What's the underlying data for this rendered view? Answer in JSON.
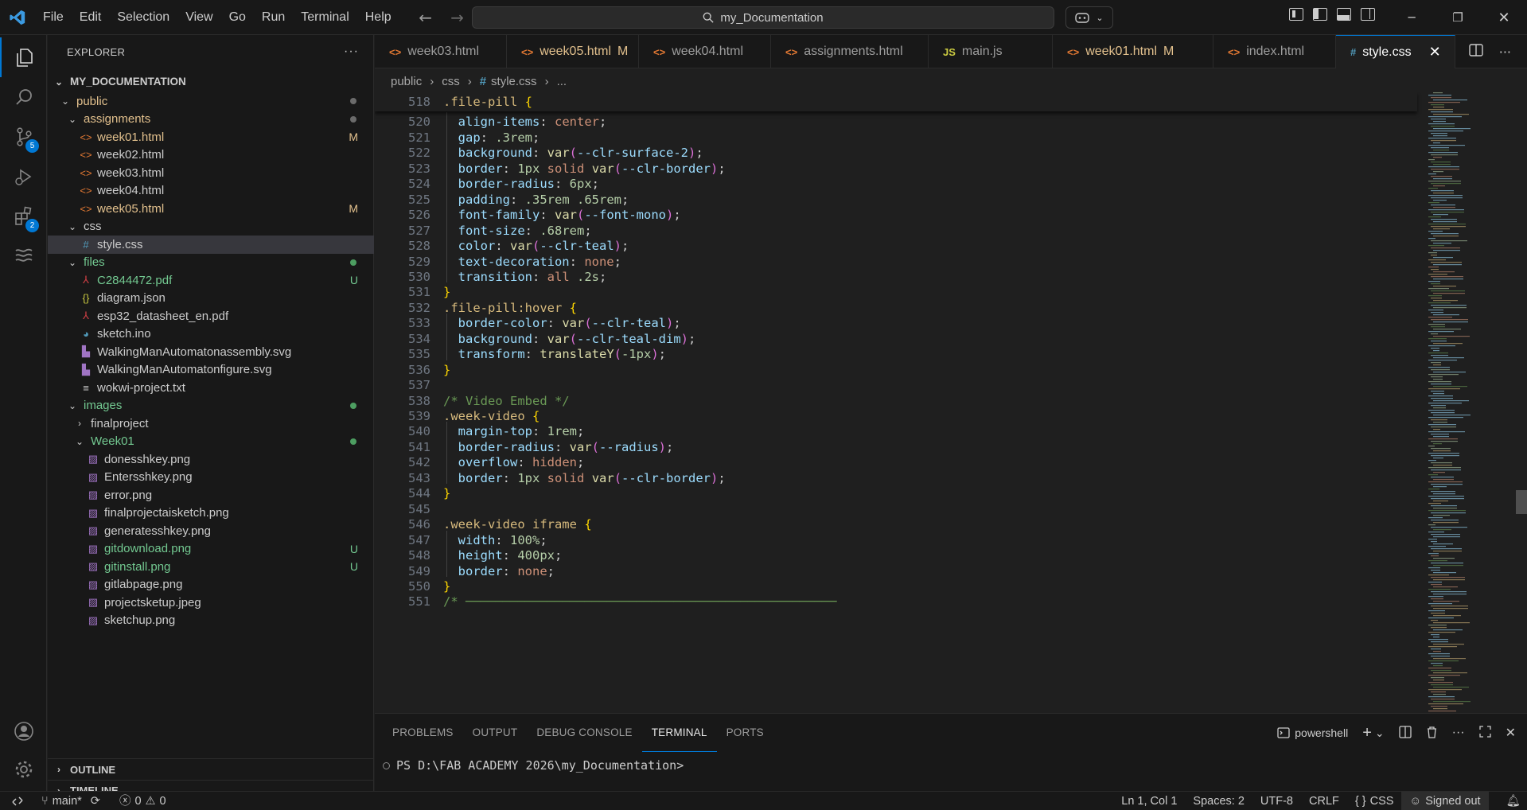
{
  "menu": [
    "File",
    "Edit",
    "Selection",
    "View",
    "Go",
    "Run",
    "Terminal",
    "Help"
  ],
  "search": {
    "text": "my_Documentation"
  },
  "activity": {
    "scm_badge": "5",
    "extensions_badge": "2"
  },
  "explorer": {
    "title": "EXPLORER",
    "root": "MY_DOCUMENTATION",
    "items": [
      {
        "label": "public",
        "depth": 0,
        "kind": "folder-open",
        "color": "#e2c08d",
        "marker": "dot",
        "marker_color": "#6b6b6b"
      },
      {
        "label": "assignments",
        "depth": 1,
        "kind": "folder-open",
        "color": "#e2c08d",
        "marker": "dot",
        "marker_color": "#6b6b6b"
      },
      {
        "label": "week01.html",
        "depth": 2,
        "kind": "html",
        "color": "#e2c08d",
        "marker": "M",
        "marker_color": "#e2c08d"
      },
      {
        "label": "week02.html",
        "depth": 2,
        "kind": "html",
        "color": "#cccccc",
        "marker": "",
        "marker_color": ""
      },
      {
        "label": "week03.html",
        "depth": 2,
        "kind": "html",
        "color": "#cccccc",
        "marker": "",
        "marker_color": ""
      },
      {
        "label": "week04.html",
        "depth": 2,
        "kind": "html",
        "color": "#cccccc",
        "marker": "",
        "marker_color": ""
      },
      {
        "label": "week05.html",
        "depth": 2,
        "kind": "html",
        "color": "#e2c08d",
        "marker": "M",
        "marker_color": "#e2c08d"
      },
      {
        "label": "css",
        "depth": 1,
        "kind": "folder-open",
        "color": "#cccccc",
        "marker": "",
        "marker_color": ""
      },
      {
        "label": "style.css",
        "depth": 2,
        "kind": "css",
        "color": "#cccccc",
        "marker": "",
        "marker_color": "",
        "selected": true
      },
      {
        "label": "files",
        "depth": 1,
        "kind": "folder-open",
        "color": "#73c991",
        "marker": "dot",
        "marker_color": "#4d9e61"
      },
      {
        "label": "C2844472.pdf",
        "depth": 2,
        "kind": "pdf",
        "color": "#73c991",
        "marker": "U",
        "marker_color": "#73c991"
      },
      {
        "label": "diagram.json",
        "depth": 2,
        "kind": "json",
        "color": "#cccccc",
        "marker": "",
        "marker_color": ""
      },
      {
        "label": "esp32_datasheet_en.pdf",
        "depth": 2,
        "kind": "pdf",
        "color": "#cccccc",
        "marker": "",
        "marker_color": ""
      },
      {
        "label": "sketch.ino",
        "depth": 2,
        "kind": "ino",
        "color": "#cccccc",
        "marker": "",
        "marker_color": ""
      },
      {
        "label": "WalkingManAutomatonassembly.svg",
        "depth": 2,
        "kind": "svg",
        "color": "#cccccc",
        "marker": "",
        "marker_color": ""
      },
      {
        "label": "WalkingManAutomatonfigure.svg",
        "depth": 2,
        "kind": "svg",
        "color": "#cccccc",
        "marker": "",
        "marker_color": ""
      },
      {
        "label": "wokwi-project.txt",
        "depth": 2,
        "kind": "txt",
        "color": "#cccccc",
        "marker": "",
        "marker_color": ""
      },
      {
        "label": "images",
        "depth": 1,
        "kind": "folder-open",
        "color": "#73c991",
        "marker": "dot",
        "marker_color": "#4d9e61"
      },
      {
        "label": "finalproject",
        "depth": 2,
        "kind": "folder-closed",
        "color": "#cccccc",
        "marker": "",
        "marker_color": ""
      },
      {
        "label": "Week01",
        "depth": 2,
        "kind": "folder-open",
        "color": "#73c991",
        "marker": "dot",
        "marker_color": "#4d9e61"
      },
      {
        "label": "donesshkey.png",
        "depth": 3,
        "kind": "png",
        "color": "#cccccc",
        "marker": "",
        "marker_color": ""
      },
      {
        "label": "Entersshkey.png",
        "depth": 3,
        "kind": "png",
        "color": "#cccccc",
        "marker": "",
        "marker_color": ""
      },
      {
        "label": "error.png",
        "depth": 3,
        "kind": "png",
        "color": "#cccccc",
        "marker": "",
        "marker_color": ""
      },
      {
        "label": "finalprojectaisketch.png",
        "depth": 3,
        "kind": "png",
        "color": "#cccccc",
        "marker": "",
        "marker_color": ""
      },
      {
        "label": "generatesshkey.png",
        "depth": 3,
        "kind": "png",
        "color": "#cccccc",
        "marker": "",
        "marker_color": ""
      },
      {
        "label": "gitdownload.png",
        "depth": 3,
        "kind": "png",
        "color": "#73c991",
        "marker": "U",
        "marker_color": "#73c991"
      },
      {
        "label": "gitinstall.png",
        "depth": 3,
        "kind": "png",
        "color": "#73c991",
        "marker": "U",
        "marker_color": "#73c991"
      },
      {
        "label": "gitlabpage.png",
        "depth": 3,
        "kind": "png",
        "color": "#cccccc",
        "marker": "",
        "marker_color": ""
      },
      {
        "label": "projectsketup.jpeg",
        "depth": 3,
        "kind": "png",
        "color": "#cccccc",
        "marker": "",
        "marker_color": ""
      },
      {
        "label": "sketchup.png",
        "depth": 3,
        "kind": "png",
        "color": "#cccccc",
        "marker": "",
        "marker_color": ""
      }
    ],
    "outline": "OUTLINE",
    "timeline": "TIMELINE"
  },
  "tabs": [
    {
      "label": "week03.html",
      "icon": "<>",
      "icon_color": "#e37933",
      "color": "#9d9d9d",
      "mod": ""
    },
    {
      "label": "week05.html",
      "icon": "<>",
      "icon_color": "#e37933",
      "color": "#e2c08d",
      "mod": "M"
    },
    {
      "label": "week04.html",
      "icon": "<>",
      "icon_color": "#e37933",
      "color": "#9d9d9d",
      "mod": ""
    },
    {
      "label": "assignments.html",
      "icon": "<>",
      "icon_color": "#e37933",
      "color": "#9d9d9d",
      "mod": ""
    },
    {
      "label": "main.js",
      "icon": "JS",
      "icon_color": "#cbcb41",
      "color": "#9d9d9d",
      "mod": ""
    },
    {
      "label": "week01.html",
      "icon": "<>",
      "icon_color": "#e37933",
      "color": "#e2c08d",
      "mod": "M"
    },
    {
      "label": "index.html",
      "icon": "<>",
      "icon_color": "#e37933",
      "color": "#9d9d9d",
      "mod": ""
    },
    {
      "label": "style.css",
      "icon": "#",
      "icon_color": "#519aba",
      "color": "#ffffff",
      "mod": "",
      "active": true
    }
  ],
  "breadcrumb": [
    "public",
    "css",
    "style.css",
    "..."
  ],
  "code": [
    {
      "n": "518",
      "sticky": true,
      "t": [
        [
          ".file-pill",
          "sel"
        ],
        [
          " ",
          ""
        ],
        [
          "{",
          "br"
        ]
      ]
    },
    {
      "n": "520",
      "t": [
        [
          "  align-items",
          "prop"
        ],
        [
          ": ",
          "p"
        ],
        [
          "center",
          "val"
        ],
        [
          ";",
          "p"
        ]
      ]
    },
    {
      "n": "521",
      "t": [
        [
          "  gap",
          "prop"
        ],
        [
          ": ",
          "p"
        ],
        [
          ".3rem",
          "num"
        ],
        [
          ";",
          "p"
        ]
      ]
    },
    {
      "n": "522",
      "t": [
        [
          "  background",
          "prop"
        ],
        [
          ": ",
          "p"
        ],
        [
          "var",
          "fn"
        ],
        [
          "(",
          "br2"
        ],
        [
          "--clr-surface-2",
          "var"
        ],
        [
          ")",
          "br2"
        ],
        [
          ";",
          "p"
        ]
      ]
    },
    {
      "n": "523",
      "t": [
        [
          "  border",
          "prop"
        ],
        [
          ": ",
          "p"
        ],
        [
          "1px",
          "num"
        ],
        [
          " ",
          "p"
        ],
        [
          "solid",
          "val"
        ],
        [
          " ",
          "p"
        ],
        [
          "var",
          "fn"
        ],
        [
          "(",
          "br2"
        ],
        [
          "--clr-border",
          "var"
        ],
        [
          ")",
          "br2"
        ],
        [
          ";",
          "p"
        ]
      ]
    },
    {
      "n": "524",
      "t": [
        [
          "  border-radius",
          "prop"
        ],
        [
          ": ",
          "p"
        ],
        [
          "6px",
          "num"
        ],
        [
          ";",
          "p"
        ]
      ]
    },
    {
      "n": "525",
      "t": [
        [
          "  padding",
          "prop"
        ],
        [
          ": ",
          "p"
        ],
        [
          ".35rem",
          "num"
        ],
        [
          " ",
          "p"
        ],
        [
          ".65rem",
          "num"
        ],
        [
          ";",
          "p"
        ]
      ]
    },
    {
      "n": "526",
      "t": [
        [
          "  font-family",
          "prop"
        ],
        [
          ": ",
          "p"
        ],
        [
          "var",
          "fn"
        ],
        [
          "(",
          "br2"
        ],
        [
          "--font-mono",
          "var"
        ],
        [
          ")",
          "br2"
        ],
        [
          ";",
          "p"
        ]
      ]
    },
    {
      "n": "527",
      "t": [
        [
          "  font-size",
          "prop"
        ],
        [
          ": ",
          "p"
        ],
        [
          ".68rem",
          "num"
        ],
        [
          ";",
          "p"
        ]
      ]
    },
    {
      "n": "528",
      "t": [
        [
          "  color",
          "prop"
        ],
        [
          ": ",
          "p"
        ],
        [
          "var",
          "fn"
        ],
        [
          "(",
          "br2"
        ],
        [
          "--clr-teal",
          "var"
        ],
        [
          ")",
          "br2"
        ],
        [
          ";",
          "p"
        ]
      ]
    },
    {
      "n": "529",
      "t": [
        [
          "  text-decoration",
          "prop"
        ],
        [
          ": ",
          "p"
        ],
        [
          "none",
          "val"
        ],
        [
          ";",
          "p"
        ]
      ]
    },
    {
      "n": "530",
      "t": [
        [
          "  transition",
          "prop"
        ],
        [
          ": ",
          "p"
        ],
        [
          "all",
          "val"
        ],
        [
          " ",
          "p"
        ],
        [
          ".2s",
          "num"
        ],
        [
          ";",
          "p"
        ]
      ]
    },
    {
      "n": "531",
      "t": [
        [
          "}",
          "br"
        ]
      ]
    },
    {
      "n": "532",
      "t": [
        [
          ".file-pill:hover",
          "sel"
        ],
        [
          " ",
          ""
        ],
        [
          "{",
          "br"
        ]
      ]
    },
    {
      "n": "533",
      "t": [
        [
          "  border-color",
          "prop"
        ],
        [
          ": ",
          "p"
        ],
        [
          "var",
          "fn"
        ],
        [
          "(",
          "br2"
        ],
        [
          "--clr-teal",
          "var"
        ],
        [
          ")",
          "br2"
        ],
        [
          ";",
          "p"
        ]
      ]
    },
    {
      "n": "534",
      "t": [
        [
          "  background",
          "prop"
        ],
        [
          ": ",
          "p"
        ],
        [
          "var",
          "fn"
        ],
        [
          "(",
          "br2"
        ],
        [
          "--clr-teal-dim",
          "var"
        ],
        [
          ")",
          "br2"
        ],
        [
          ";",
          "p"
        ]
      ]
    },
    {
      "n": "535",
      "t": [
        [
          "  transform",
          "prop"
        ],
        [
          ": ",
          "p"
        ],
        [
          "translateY",
          "fn"
        ],
        [
          "(",
          "br2"
        ],
        [
          "-1px",
          "num"
        ],
        [
          ")",
          "br2"
        ],
        [
          ";",
          "p"
        ]
      ]
    },
    {
      "n": "536",
      "t": [
        [
          "}",
          "br"
        ]
      ]
    },
    {
      "n": "537",
      "t": []
    },
    {
      "n": "538",
      "t": [
        [
          "/* Video Embed */",
          "cmt"
        ]
      ]
    },
    {
      "n": "539",
      "t": [
        [
          ".week-video",
          "sel"
        ],
        [
          " ",
          ""
        ],
        [
          "{",
          "br"
        ]
      ]
    },
    {
      "n": "540",
      "t": [
        [
          "  margin-top",
          "prop"
        ],
        [
          ": ",
          "p"
        ],
        [
          "1rem",
          "num"
        ],
        [
          ";",
          "p"
        ]
      ]
    },
    {
      "n": "541",
      "t": [
        [
          "  border-radius",
          "prop"
        ],
        [
          ": ",
          "p"
        ],
        [
          "var",
          "fn"
        ],
        [
          "(",
          "br2"
        ],
        [
          "--radius",
          "var"
        ],
        [
          ")",
          "br2"
        ],
        [
          ";",
          "p"
        ]
      ]
    },
    {
      "n": "542",
      "t": [
        [
          "  overflow",
          "prop"
        ],
        [
          ": ",
          "p"
        ],
        [
          "hidden",
          "val"
        ],
        [
          ";",
          "p"
        ]
      ]
    },
    {
      "n": "543",
      "t": [
        [
          "  border",
          "prop"
        ],
        [
          ": ",
          "p"
        ],
        [
          "1px",
          "num"
        ],
        [
          " ",
          "p"
        ],
        [
          "solid",
          "val"
        ],
        [
          " ",
          "p"
        ],
        [
          "var",
          "fn"
        ],
        [
          "(",
          "br2"
        ],
        [
          "--clr-border",
          "var"
        ],
        [
          ")",
          "br2"
        ],
        [
          ";",
          "p"
        ]
      ]
    },
    {
      "n": "544",
      "t": [
        [
          "}",
          "br"
        ]
      ]
    },
    {
      "n": "545",
      "t": []
    },
    {
      "n": "546",
      "t": [
        [
          ".week-video iframe",
          "sel"
        ],
        [
          " ",
          ""
        ],
        [
          "{",
          "br"
        ]
      ]
    },
    {
      "n": "547",
      "t": [
        [
          "  width",
          "prop"
        ],
        [
          ": ",
          "p"
        ],
        [
          "100%",
          "num"
        ],
        [
          ";",
          "p"
        ]
      ]
    },
    {
      "n": "548",
      "t": [
        [
          "  height",
          "prop"
        ],
        [
          ": ",
          "p"
        ],
        [
          "400px",
          "num"
        ],
        [
          ";",
          "p"
        ]
      ]
    },
    {
      "n": "549",
      "t": [
        [
          "  border",
          "prop"
        ],
        [
          ": ",
          "p"
        ],
        [
          "none",
          "val"
        ],
        [
          ";",
          "p"
        ]
      ]
    },
    {
      "n": "550",
      "t": [
        [
          "}",
          "br"
        ]
      ]
    },
    {
      "n": "551",
      "t": [
        [
          "/* ──────────────────────────────────────────────────",
          "cmt"
        ]
      ]
    }
  ],
  "syntax_colors": {
    "sel": "#d7ba7d",
    "prop": "#9cdcfe",
    "p": "#cccccc",
    "val": "#ce9178",
    "num": "#b5cea8",
    "fn": "#dcdcaa",
    "var": "#9cdcfe",
    "br": "#ffd700",
    "br2": "#da70d6",
    "cmt": "#6a9955",
    "": "#cccccc"
  },
  "panel": {
    "tabs": [
      "PROBLEMS",
      "OUTPUT",
      "DEBUG CONSOLE",
      "TERMINAL",
      "PORTS"
    ],
    "active_tab": "TERMINAL",
    "shell": "powershell",
    "prompt": "PS D:\\FAB ACADEMY 2026\\my_Documentation>"
  },
  "status": {
    "branch": "main*",
    "errors": "0",
    "warnings": "0",
    "position": "Ln 1, Col 1",
    "spaces": "Spaces: 2",
    "encoding": "UTF-8",
    "eol": "CRLF",
    "language": "CSS",
    "account": "Signed out"
  }
}
